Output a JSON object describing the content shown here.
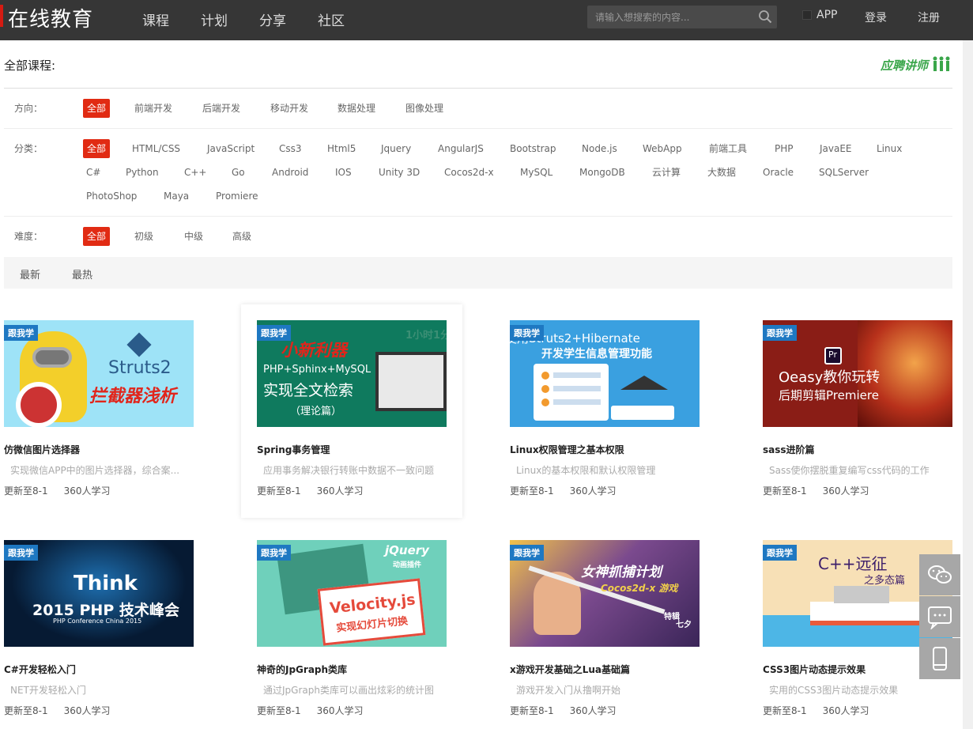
{
  "header": {
    "logo": "在线教育",
    "nav": [
      "课程",
      "计划",
      "分享",
      "社区"
    ],
    "search_placeholder": "请输入想搜索的内容...",
    "app_label": "APP",
    "login": "登录",
    "register": "注册"
  },
  "section": {
    "all_courses": "全部课程:",
    "recruit": "应聘讲师"
  },
  "filters": {
    "direction": {
      "label": "方向：",
      "items": [
        "全部",
        "前端开发",
        "后端开发",
        "移动开发",
        "数据处理",
        "图像处理"
      ]
    },
    "category": {
      "label": "分类：",
      "items": [
        "全部",
        "HTML/CSS",
        "JavaScript",
        "Css3",
        "Html5",
        "Jquery",
        "AngularJS",
        "Bootstrap",
        "Node.js",
        "WebApp",
        "前端工具",
        "PHP",
        "JavaEE",
        "Linux",
        "C#",
        "Python",
        "C++",
        "Go",
        "Android",
        "IOS",
        "Unity 3D",
        "Cocos2d-x",
        "MySQL",
        "MongoDB",
        "云计算",
        "大数据",
        "Oracle",
        "SQLServer",
        "PhotoShop",
        "Maya",
        "Promiere"
      ]
    },
    "difficulty": {
      "label": "难度：",
      "items": [
        "全部",
        "初级",
        "中级",
        "高级"
      ]
    }
  },
  "sort": [
    "最新",
    "最热"
  ],
  "courses": [
    {
      "badge": "跟我学",
      "title": "仿微信图片选择器",
      "desc": "实现微信APP中的图片选择器，综合案...",
      "updated": "更新至8-1",
      "students": "360人学习",
      "thumb_lines": [
        "Struts2",
        "拦截器浅析"
      ],
      "bg": "#9ee3f7"
    },
    {
      "badge": "跟我学",
      "title": "Spring事务管理",
      "desc": "应用事务解决银行转账中数据不一致问题",
      "updated": "更新至8-1",
      "students": "360人学习",
      "thumb_lines": [
        "小新利器",
        "PHP+Sphinx+MySQL",
        "实现全文检索",
        "（理论篇）",
        "1小时1分"
      ],
      "bg": "#0f7a5e"
    },
    {
      "badge": "跟我学",
      "title": "Linux权限管理之基本权限",
      "desc": "Linux的基本权限和默认权限管理",
      "updated": "更新至8-1",
      "students": "360人学习",
      "thumb_lines": [
        "使用Struts2+Hibernate",
        "开发学生信息管理功能"
      ],
      "bg": "#3aa0e0"
    },
    {
      "badge": "跟我学",
      "title": "sass进阶篇",
      "desc": "Sass使你摆脱重复编写css代码的工作",
      "updated": "更新至8-1",
      "students": "360人学习",
      "thumb_lines": [
        "Oeasy教你玩转",
        "后期剪辑Premiere",
        "Pr"
      ],
      "bg": "#8a1d16"
    },
    {
      "badge": "跟我学",
      "title": "C#开发轻松入门",
      "desc": "NET开发轻松入门",
      "updated": "更新至8-1",
      "students": "360人学习",
      "thumb_lines": [
        "Think",
        "2015 PHP 技术峰会",
        "PHP   Conference   China   2015"
      ],
      "bg": "#061a33"
    },
    {
      "badge": "跟我学",
      "title": "神奇的JpGraph类库",
      "desc": "通过JpGraph类库可以画出炫彩的统计图",
      "updated": "更新至8-1",
      "students": "360人学习",
      "thumb_lines": [
        "jQuery",
        "动画插件",
        "Velocity.js",
        "实现幻灯片切换"
      ],
      "bg": "#6fd0bb"
    },
    {
      "badge": "跟我学",
      "title": "x游戏开发基础之Lua基础篇",
      "desc": "游戏开发入门从撸啊开始",
      "updated": "更新至8-1",
      "students": "360人学习",
      "thumb_lines": [
        "女神抓捕计划",
        "Cocos2d-x 游戏",
        "特辑",
        "七夕"
      ],
      "bg": "#5a3a78"
    },
    {
      "badge": "跟我学",
      "title": "CSS3图片动态提示效果",
      "desc": "实用的CSS3图片动态提示效果",
      "updated": "更新至8-1",
      "students": "360人学习",
      "thumb_lines": [
        "C++远征",
        "之多态篇"
      ],
      "bg": "#f7e0b6"
    }
  ],
  "colors": {
    "topbar": "#363636",
    "accent_red": "#e12b13",
    "badge_blue": "#1e78c2",
    "recruit_green": "#3aa64a"
  }
}
